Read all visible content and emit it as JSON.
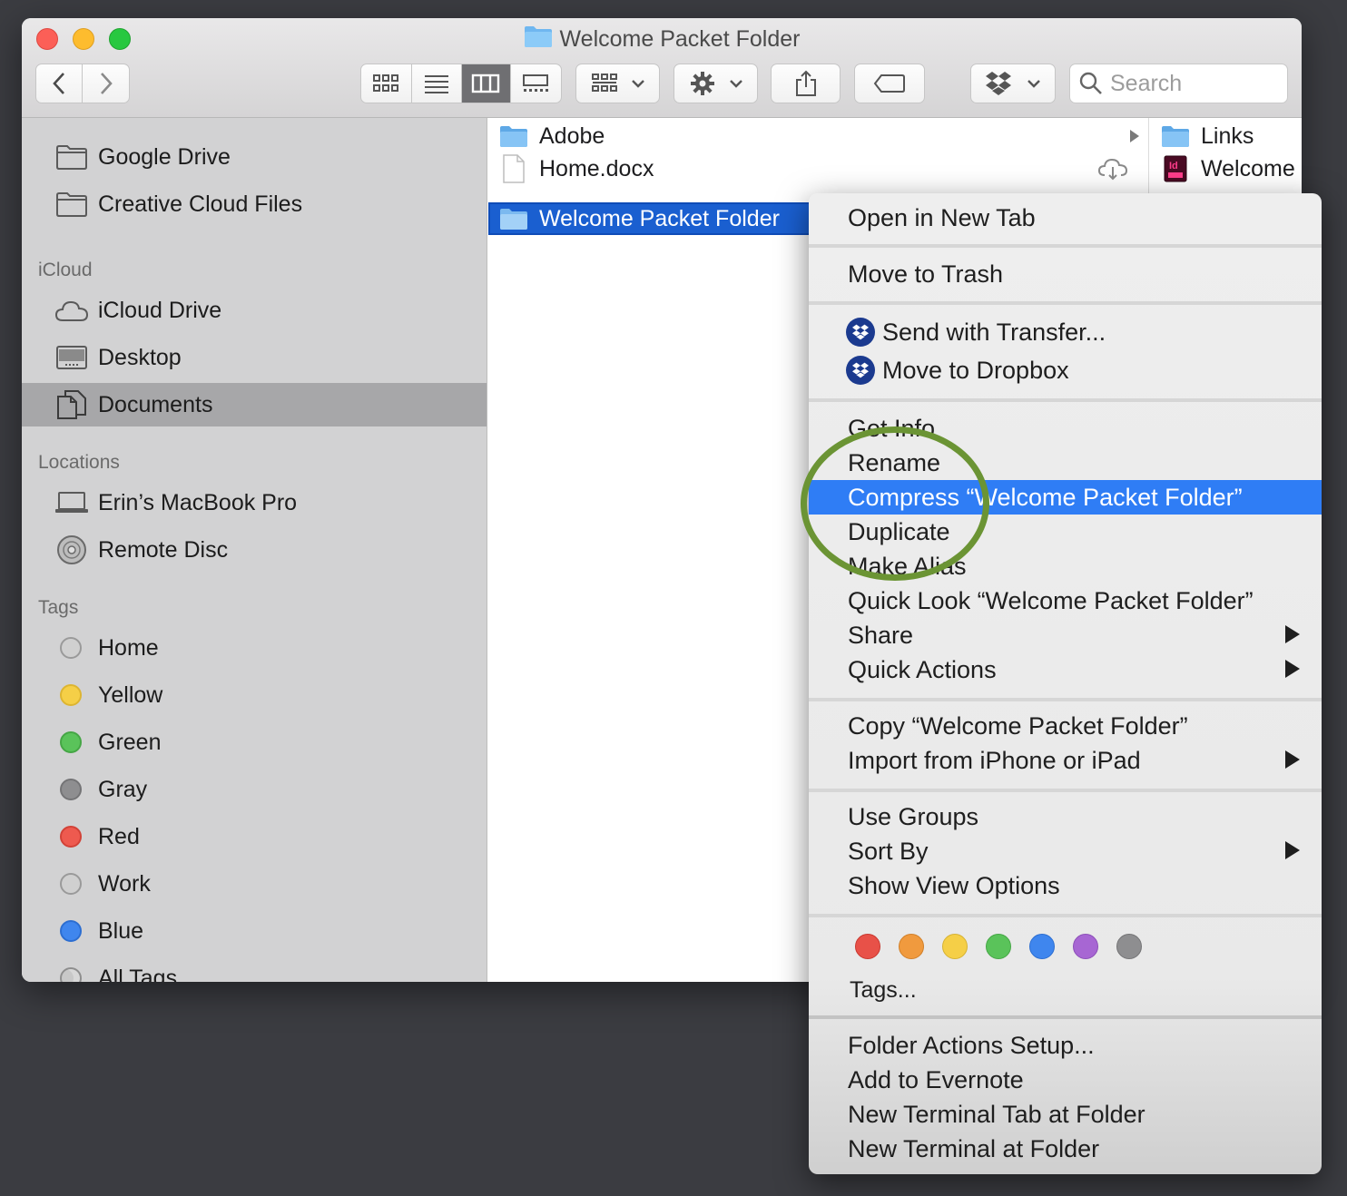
{
  "window": {
    "title": "Welcome Packet Folder",
    "search_placeholder": "Search"
  },
  "toolbar": {
    "back": "back",
    "forward": "forward",
    "view_modes": [
      "icon-view",
      "list-view",
      "column-view",
      "gallery-view"
    ],
    "active_view": "column-view"
  },
  "sidebar": {
    "favorites": [
      {
        "label": "Google Drive",
        "icon": "folder-icon"
      },
      {
        "label": "Creative Cloud Files",
        "icon": "folder-icon"
      }
    ],
    "icloud_header": "iCloud",
    "icloud": [
      {
        "label": "iCloud Drive",
        "icon": "cloud-icon"
      },
      {
        "label": "Desktop",
        "icon": "desktop-icon"
      },
      {
        "label": "Documents",
        "icon": "documents-icon",
        "selected": true
      }
    ],
    "locations_header": "Locations",
    "locations": [
      {
        "label": "Erin’s MacBook Pro",
        "icon": "laptop-icon"
      },
      {
        "label": "Remote Disc",
        "icon": "disc-icon"
      }
    ],
    "tags_header": "Tags",
    "tags": [
      {
        "label": "Home",
        "color": "#d0d0d0"
      },
      {
        "label": "Yellow",
        "color": "#f5cf47"
      },
      {
        "label": "Green",
        "color": "#5ac35a"
      },
      {
        "label": "Gray",
        "color": "#8e8e90"
      },
      {
        "label": "Red",
        "color": "#ee5a4f"
      },
      {
        "label": "Work",
        "color": "#d0d0d0"
      },
      {
        "label": "Blue",
        "color": "#3f86ee"
      },
      {
        "label": "All Tags...",
        "color": "#c8c8c8"
      }
    ]
  },
  "column1": {
    "items": [
      {
        "label": "Adobe",
        "icon": "folder-icon"
      },
      {
        "label": "Home.docx",
        "icon": "document-icon"
      },
      {
        "label": "Welcome Packet Folder",
        "icon": "folder-icon",
        "selected": true
      }
    ]
  },
  "column2": {
    "items": [
      {
        "label": "Links",
        "icon": "folder-icon"
      },
      {
        "label": "Welcome",
        "icon": "indesign-icon"
      }
    ]
  },
  "context_menu": {
    "open_new_tab": "Open in New Tab",
    "move_to_trash": "Move to Trash",
    "send_transfer": "Send with Transfer...",
    "move_dropbox": "Move to Dropbox",
    "get_info": "Get Info",
    "rename": "Rename",
    "compress": "Compress “Welcome Packet Folder”",
    "duplicate": "Duplicate",
    "make_alias": "Make Alias",
    "quick_look": "Quick Look “Welcome Packet Folder”",
    "share": "Share",
    "quick_actions": "Quick Actions",
    "copy": "Copy “Welcome Packet Folder”",
    "import_iphone": "Import from iPhone or iPad",
    "use_groups": "Use Groups",
    "sort_by": "Sort By",
    "show_view_options": "Show View Options",
    "tag_colors": [
      "#e85148",
      "#f09a3e",
      "#f5cf47",
      "#5ac35a",
      "#3f86ee",
      "#a766d3",
      "#8e8e90"
    ],
    "tags": "Tags...",
    "folder_actions": "Folder Actions Setup...",
    "add_evernote": "Add to Evernote",
    "new_terminal_tab": "New Terminal Tab at Folder",
    "new_terminal": "New Terminal at Folder"
  }
}
